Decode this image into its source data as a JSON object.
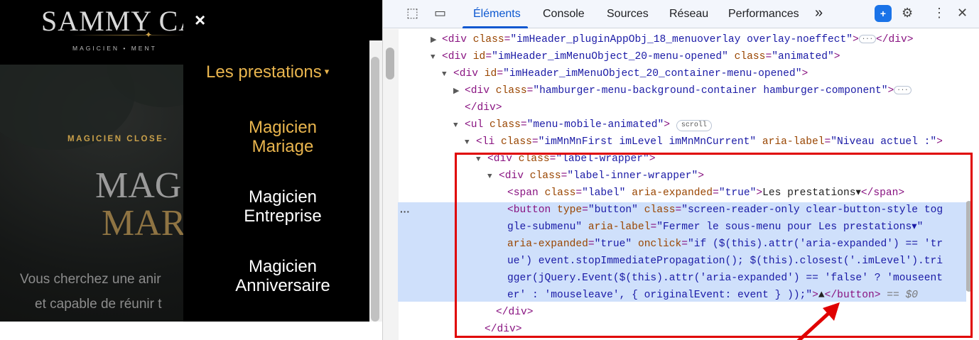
{
  "site": {
    "logo_text": "SAMMY CA",
    "logo_tagline": "MAGICIEN • MENT",
    "hero_kicker": "MAGICIEN CLOSE-",
    "hero_title_line1": "MAG",
    "hero_title_line2": "MAR",
    "hero_text_line1": "Vous cherchez une anir",
    "hero_text_line2": "et capable de réunir t",
    "menu": {
      "close_icon": "×",
      "current_label": "Les prestations",
      "current_arrow": "▾",
      "items": [
        {
          "line1": "Magicien",
          "line2": "Mariage",
          "active": true
        },
        {
          "line1": "Magicien",
          "line2": "Entreprise",
          "active": false
        },
        {
          "line1": "Magicien",
          "line2": "Anniversaire",
          "active": false
        }
      ]
    }
  },
  "devtools": {
    "tabs": [
      "Éléments",
      "Console",
      "Sources",
      "Réseau",
      "Performances"
    ],
    "more_tabs": "»",
    "accent_color": "#0b57d0",
    "highlight_color": "#cfe0fb",
    "annotation_color": "#e00000",
    "lines": {
      "l1": {
        "tag_open": "<div",
        "a1": "class",
        "v1": "\"imHeader_pluginAppObj_18_menuoverlay overlay-noeffect\"",
        "close": ">",
        "end": "</div>"
      },
      "l2": {
        "tag_open": "<div",
        "a1": "id",
        "v1": "\"imHeader_imMenuObject_20-menu-opened\"",
        "a2": "class",
        "v2": "\"animated\"",
        "close": ">"
      },
      "l3": {
        "tag_open": "<div",
        "a1": "id",
        "v1": "\"imHeader_imMenuObject_20_container-menu-opened\"",
        "close": ">"
      },
      "l4": {
        "tag_open": "<div",
        "a1": "class",
        "v1": "\"hamburger-menu-background-container hamburger-component\"",
        "close": ">"
      },
      "l5": {
        "end": "</div>"
      },
      "l6": {
        "tag_open": "<ul",
        "a1": "class",
        "v1": "\"menu-mobile-animated\"",
        "close": ">",
        "badge": "scroll"
      },
      "l7": {
        "tag_open": "<li",
        "a1": "class",
        "v1": "\"imMnMnFirst imLevel imMnMnCurrent\"",
        "a2": "aria-label",
        "v2": "\"Niveau actuel :\"",
        "close": ">"
      },
      "l8": {
        "tag_open": "<div",
        "a1": "class",
        "v1": "\"label-wrapper\"",
        "close": ">"
      },
      "l9": {
        "tag_open": "<div",
        "a1": "class",
        "v1": "\"label-inner-wrapper\"",
        "close": ">"
      },
      "l10": {
        "tag_open": "<span",
        "a1": "class",
        "v1": "\"label\"",
        "a2": "aria-expanded",
        "v2": "\"true\"",
        "close": ">",
        "text": "Les prestations▾",
        "end": "</span>"
      },
      "l11": {
        "tag_open": "<button",
        "a1": "type",
        "v1": "\"button\"",
        "a2": "class",
        "v2": "\"screen-reader-only clear-button-style tog"
      },
      "l12": {
        "v": "gle-submenu\"",
        "a": "aria-label",
        "v2": "\"Fermer le sous-menu pour Les prestations▾\""
      },
      "l13": {
        "a": "aria-expanded",
        "v": "\"true\"",
        "a2": "onclick",
        "v2": "\"if ($(this).attr('aria-expanded') == 'tr"
      },
      "l14": {
        "v": "ue') event.stopImmediatePropagation(); $(this).closest('.imLevel').tri"
      },
      "l15": {
        "v": "gger(jQuery.Event($(this).attr('aria-expanded') == 'false' ? 'mouseent"
      },
      "l16": {
        "v": "er' : 'mouseleave', { originalEvent: event } ));\"",
        "close": ">",
        "text": "▲",
        "end": "</button>",
        "eq": "== $0"
      },
      "l17": {
        "end": "</div>"
      },
      "l18": {
        "end": "</div>"
      }
    }
  }
}
